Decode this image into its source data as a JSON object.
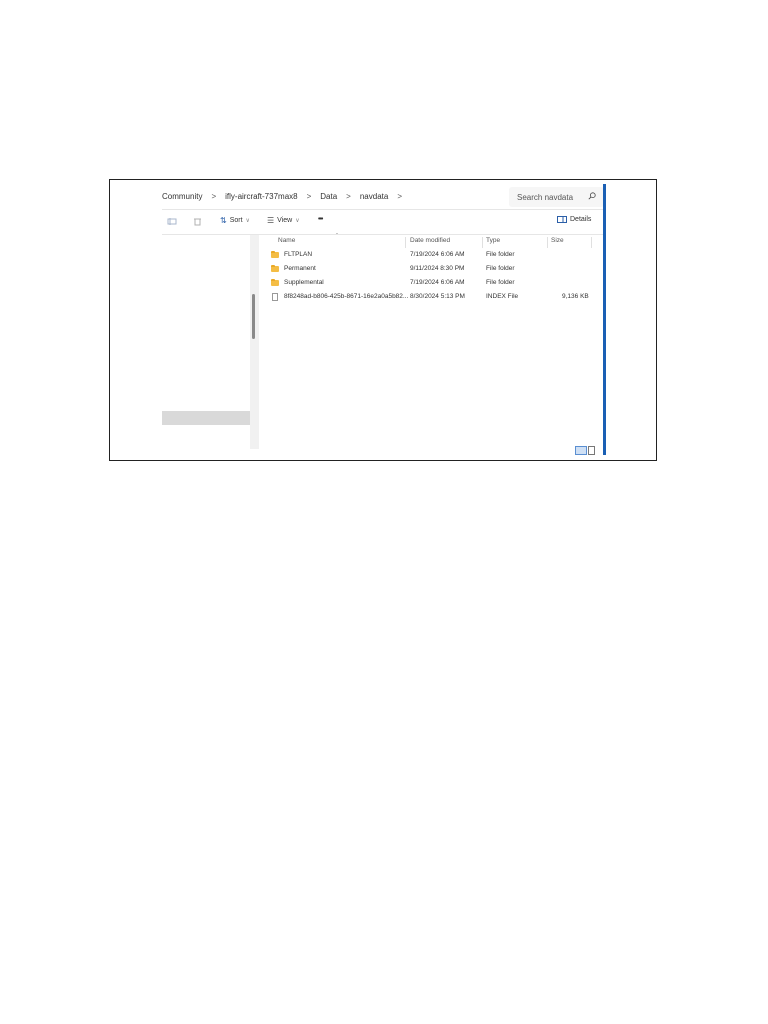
{
  "address_bar": {
    "breadcrumbs": [
      "Community",
      "ifly-aircraft-737max8",
      "Data",
      "navdata"
    ],
    "separator": ">",
    "trailing_separator": ">"
  },
  "search": {
    "placeholder": "Search navdata",
    "icon": "search-icon"
  },
  "toolbar": {
    "sort_label": "Sort",
    "view_label": "View",
    "more_label": "•••",
    "details_label": "Details",
    "dropdown_glyph": "∨"
  },
  "columns": {
    "name": "Name",
    "date": "Date modified",
    "type": "Type",
    "size": "Size"
  },
  "files": [
    {
      "name": "FLTPLAN",
      "date": "7/19/2024 6:06 AM",
      "type": "File folder",
      "size": "",
      "kind": "folder"
    },
    {
      "name": "Permanent",
      "date": "9/11/2024 8:30 PM",
      "type": "File folder",
      "size": "",
      "kind": "folder"
    },
    {
      "name": "Supplemental",
      "date": "7/19/2024 6:06 AM",
      "type": "File folder",
      "size": "",
      "kind": "folder"
    },
    {
      "name": "8f8248ad-b806-425b-8671-16e2a0a5b82...",
      "date": "8/30/2024 5:13 PM",
      "type": "INDEX File",
      "size": "9,136 KB",
      "kind": "file"
    }
  ],
  "colors": {
    "accent": "#1a5fb4",
    "folder": "#f4bd45",
    "nav_selected": "#d9d9d9"
  }
}
